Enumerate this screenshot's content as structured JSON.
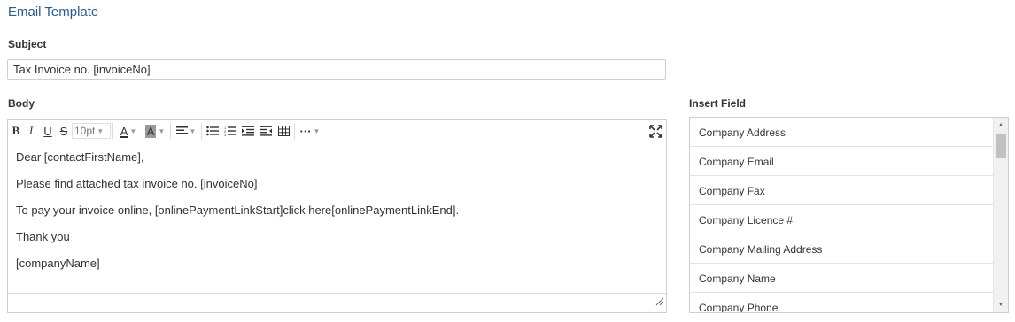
{
  "page": {
    "title": "Email Template"
  },
  "subject": {
    "label": "Subject",
    "value": "Tax Invoice no. [invoiceNo]"
  },
  "body": {
    "label": "Body",
    "toolbar": {
      "font_size": "10pt",
      "icons": [
        "bold-icon",
        "italic-icon",
        "underline-icon",
        "strikethrough-icon",
        "font-size-select",
        "font-color-icon",
        "highlight-color-icon",
        "align-icon",
        "bullet-list-icon",
        "numbered-list-icon",
        "indent-icon",
        "outdent-icon",
        "table-icon",
        "more-icon",
        "fullscreen-icon"
      ]
    },
    "paragraphs": [
      "Dear [contactFirstName],",
      "Please find attached tax invoice no. [invoiceNo]",
      "To pay your invoice online, [onlinePaymentLinkStart]click here[onlinePaymentLinkEnd].",
      "Thank you",
      "[companyName]"
    ]
  },
  "insert_field": {
    "label": "Insert Field",
    "items": [
      "Company Address",
      "Company Email",
      "Company Fax",
      "Company Licence #",
      "Company Mailing Address",
      "Company Name",
      "Company Phone"
    ]
  },
  "colors": {
    "title": "#2a5d8c",
    "border": "#cfcfcf"
  }
}
